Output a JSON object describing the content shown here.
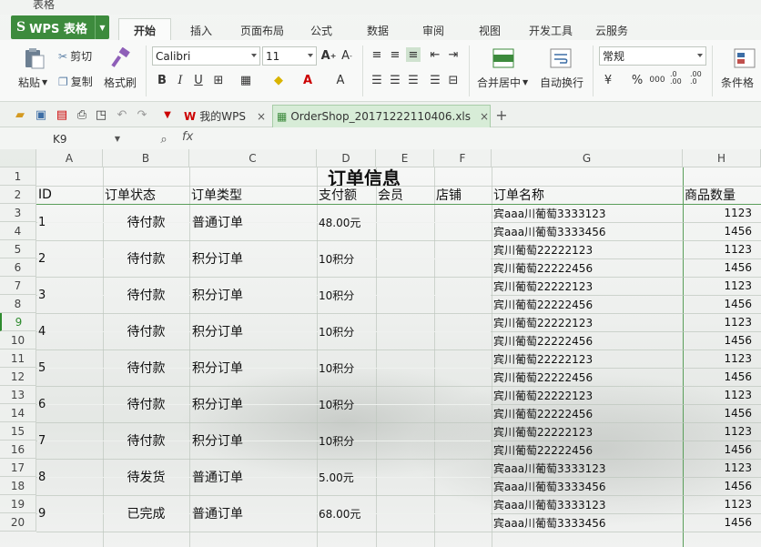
{
  "window": {
    "title": "表格"
  },
  "app": {
    "brand": "WPS 表格"
  },
  "menu_tabs": [
    "开始",
    "插入",
    "页面布局",
    "公式",
    "数据",
    "审阅",
    "视图",
    "开发工具",
    "云服务"
  ],
  "ribbon": {
    "paste": "粘贴",
    "cut": "剪切",
    "copy": "复制",
    "format_painter": "格式刷",
    "font_name": "Calibri",
    "font_size": "11",
    "merge_center": "合并居中",
    "auto_wrap": "自动换行",
    "number_format": "常规",
    "conditional": "条件格",
    "bold": "B",
    "italic": "I",
    "underline": "U",
    "percent": "%",
    "thousands": "000",
    "dec_inc": ".0 .00",
    "dec_dec": ".00 .0"
  },
  "doc_tabs": [
    {
      "label": "我的WPS"
    },
    {
      "label": "OrderShop_20171222110406.xls"
    }
  ],
  "formula_bar": {
    "name_box": "K9",
    "fx": "fx",
    "value": ""
  },
  "columns": [
    "A",
    "B",
    "C",
    "D",
    "E",
    "F",
    "G",
    "H"
  ],
  "rows": [
    "1",
    "2",
    "3",
    "4",
    "5",
    "6",
    "7",
    "8",
    "9",
    "10",
    "11",
    "12",
    "13",
    "14",
    "15",
    "16",
    "17",
    "18",
    "19",
    "20"
  ],
  "sheet": {
    "title": "订单信息",
    "headers": [
      "ID",
      "订单状态",
      "订单类型",
      "支付额",
      "会员",
      "店铺",
      "订单名称",
      "商品数量"
    ],
    "orders": [
      {
        "id": "1",
        "status": "待付款",
        "type": "普通订单",
        "amount": "48.00元",
        "items": [
          {
            "name": "宾aaa川葡萄3333123",
            "qty": "1123"
          },
          {
            "name": "宾aaa川葡萄3333456",
            "qty": "1456"
          }
        ]
      },
      {
        "id": "2",
        "status": "待付款",
        "type": "积分订单",
        "amount": "10积分",
        "items": [
          {
            "name": "宾川葡萄22222123",
            "qty": "1123"
          },
          {
            "name": "宾川葡萄22222456",
            "qty": "1456"
          }
        ]
      },
      {
        "id": "3",
        "status": "待付款",
        "type": "积分订单",
        "amount": "10积分",
        "items": [
          {
            "name": "宾川葡萄22222123",
            "qty": "1123"
          },
          {
            "name": "宾川葡萄22222456",
            "qty": "1456"
          }
        ]
      },
      {
        "id": "4",
        "status": "待付款",
        "type": "积分订单",
        "amount": "10积分",
        "items": [
          {
            "name": "宾川葡萄22222123",
            "qty": "1123"
          },
          {
            "name": "宾川葡萄22222456",
            "qty": "1456"
          }
        ]
      },
      {
        "id": "5",
        "status": "待付款",
        "type": "积分订单",
        "amount": "10积分",
        "items": [
          {
            "name": "宾川葡萄22222123",
            "qty": "1123"
          },
          {
            "name": "宾川葡萄22222456",
            "qty": "1456"
          }
        ]
      },
      {
        "id": "6",
        "status": "待付款",
        "type": "积分订单",
        "amount": "10积分",
        "items": [
          {
            "name": "宾川葡萄22222123",
            "qty": "1123"
          },
          {
            "name": "宾川葡萄22222456",
            "qty": "1456"
          }
        ]
      },
      {
        "id": "7",
        "status": "待付款",
        "type": "积分订单",
        "amount": "10积分",
        "items": [
          {
            "name": "宾川葡萄22222123",
            "qty": "1123"
          },
          {
            "name": "宾川葡萄22222456",
            "qty": "1456"
          }
        ]
      },
      {
        "id": "8",
        "status": "待发货",
        "type": "普通订单",
        "amount": "5.00元",
        "items": [
          {
            "name": "宾aaa川葡萄3333123",
            "qty": "1123"
          },
          {
            "name": "宾aaa川葡萄3333456",
            "qty": "1456"
          }
        ]
      },
      {
        "id": "9",
        "status": "已完成",
        "type": "普通订单",
        "amount": "68.00元",
        "items": [
          {
            "name": "宾aaa川葡萄3333123",
            "qty": "1123"
          },
          {
            "name": "宾aaa川葡萄3333456",
            "qty": "1456"
          }
        ]
      }
    ]
  },
  "colors": {
    "brand_green": "#3d8b3d",
    "active_row_header": "#2e8b2e"
  }
}
